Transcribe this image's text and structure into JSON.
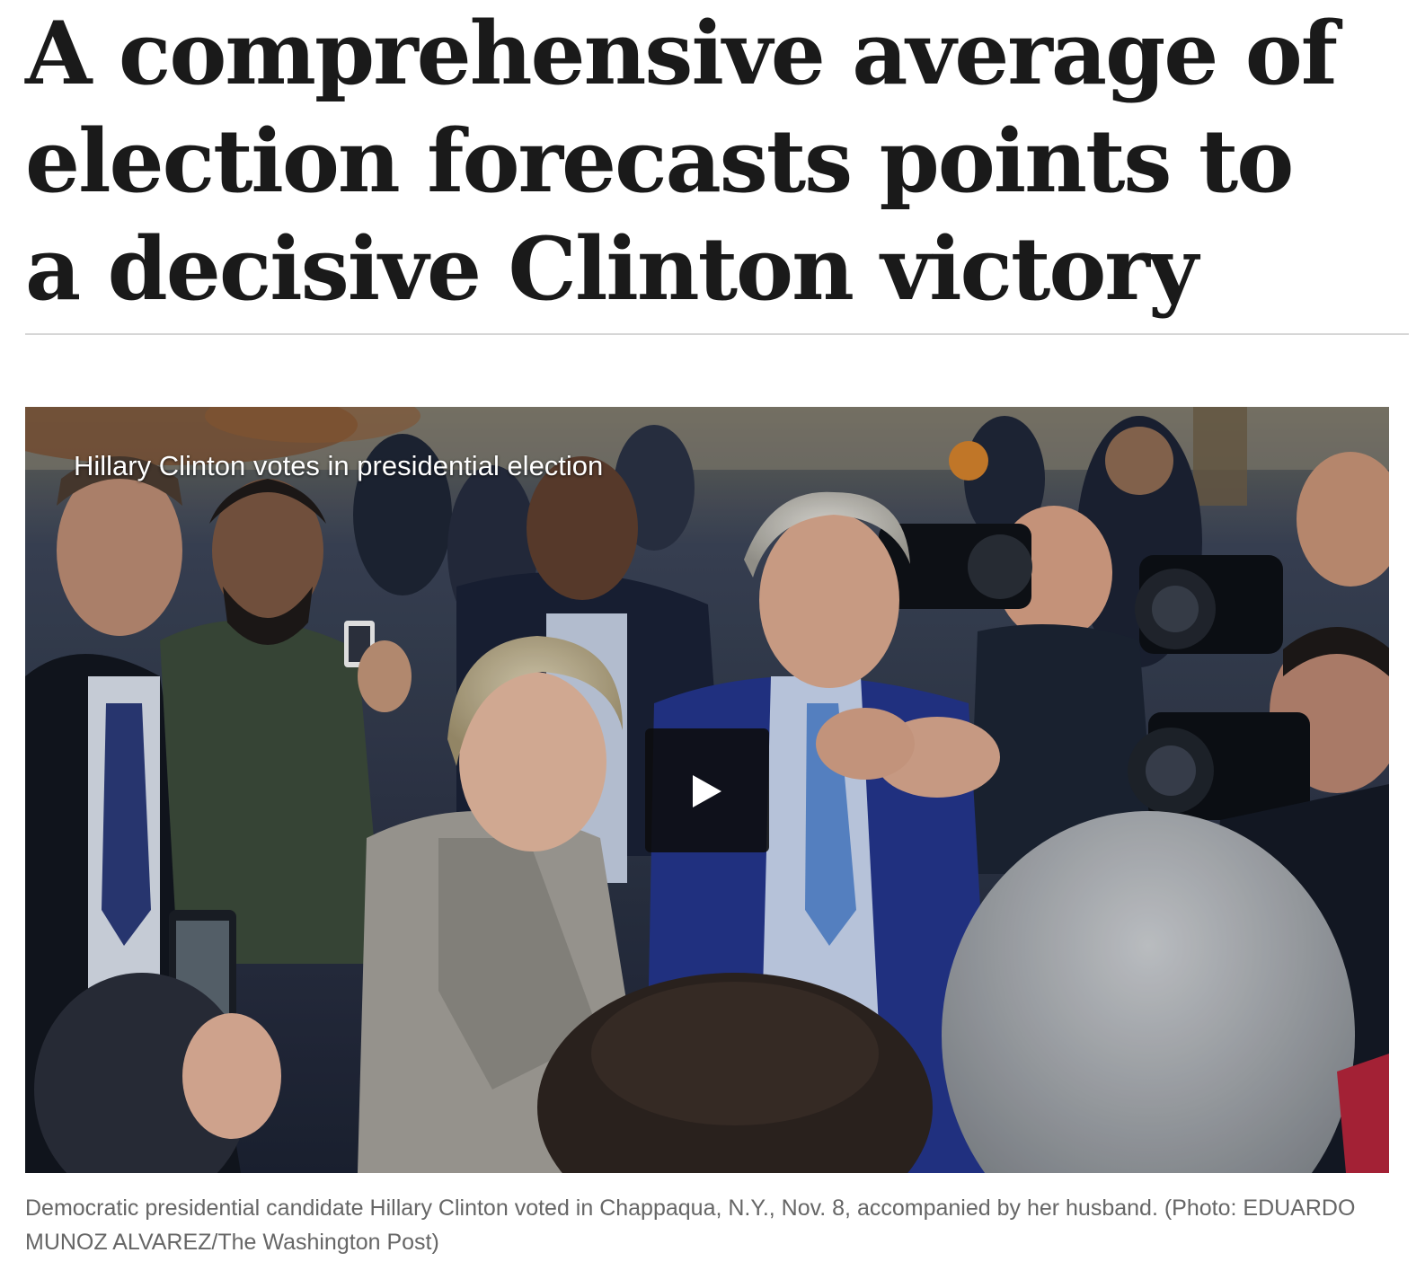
{
  "article": {
    "headline": "A comprehensive average of election forecasts points to a decisive Clinton victory"
  },
  "video": {
    "title": "Hillary Clinton votes in presidential election",
    "play_icon": "play-icon",
    "caption": "Democratic presidential candidate Hillary Clinton voted in Chappaqua, N.Y., Nov. 8, accompanied by her husband. (Photo: EDUARDO MUNOZ ALVAREZ/The Washington Post)"
  },
  "colors": {
    "headline_text": "#1a1a1a",
    "caption_text": "#666666",
    "divider": "#d6d6d6",
    "play_button_bg": "#0c0c0e"
  }
}
